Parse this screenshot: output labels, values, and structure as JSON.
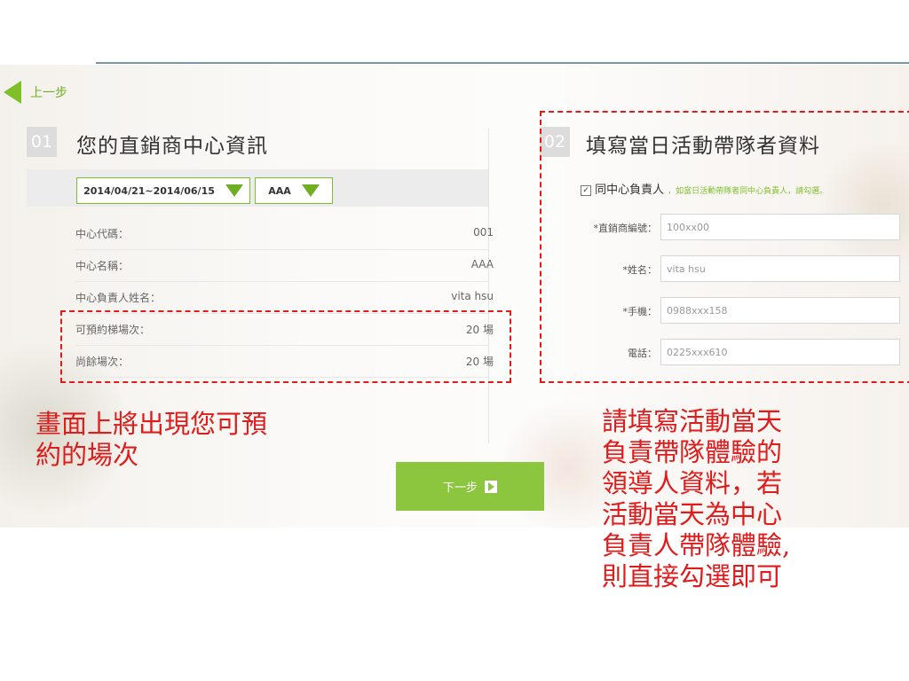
{
  "nav": {
    "back_label": "上一步"
  },
  "section1": {
    "number": "01",
    "title": "您的直銷商中心資訊",
    "date_select": "2014/04/21~2014/06/15",
    "center_select": "AAA",
    "rows": [
      {
        "label": "中心代碼：",
        "value": "001"
      },
      {
        "label": "中心名稱：",
        "value": "AAA"
      },
      {
        "label": "中心負責人姓名：",
        "value": "vita hsu"
      },
      {
        "label": "可預約梯場次：",
        "value": "20 場"
      },
      {
        "label": "尚餘場次：",
        "value": "20 場"
      }
    ]
  },
  "section2": {
    "number": "02",
    "title": "填寫當日活動帶隊者資料",
    "same_as_owner_label": "同中心負責人",
    "same_as_owner_checked": true,
    "same_as_owner_note": "，如當日活動帶隊者同中心負責人，請勾選。",
    "fields": [
      {
        "label": "*直銷商編號：",
        "value": "100xx00"
      },
      {
        "label": "*姓名：",
        "value": "vita hsu"
      },
      {
        "label": "*手機：",
        "value": "0988xxx158"
      },
      {
        "label": "電話：",
        "value": "0225xxx610"
      }
    ]
  },
  "next_label": "下一步",
  "annotations": {
    "left": [
      "畫面上將出現您可預",
      "約的場次"
    ],
    "right": [
      "請填寫活動當天",
      "負責帶隊體驗的",
      "領導人資料，若",
      "活動當天為中心",
      "負責人帶隊體驗,",
      "則直接勾選即可"
    ]
  },
  "colors": {
    "accent_green": "#8cc63f",
    "annotation_red": "#e01b1b"
  },
  "icons": {
    "back": "triangle-left-icon",
    "dropdown": "triangle-down-icon",
    "next": "play-icon"
  }
}
